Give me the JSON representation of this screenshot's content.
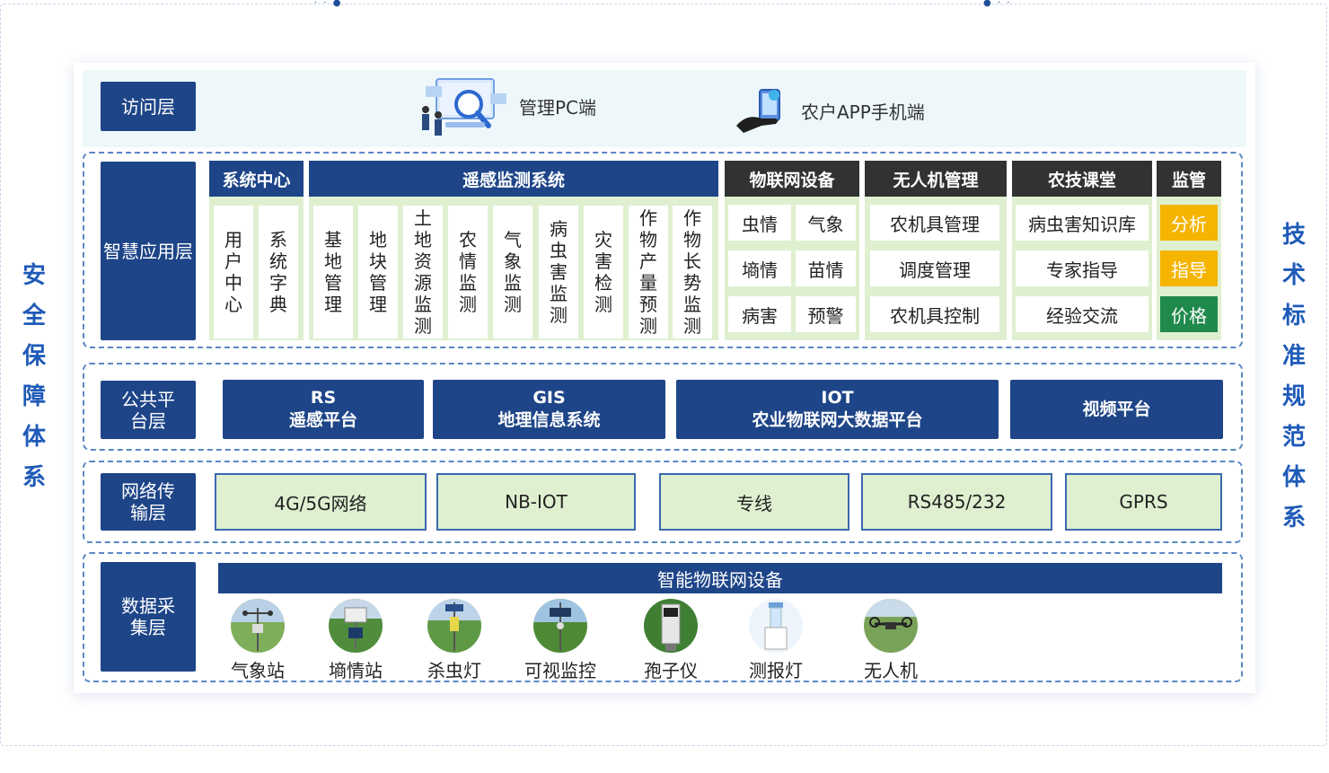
{
  "side_left": "安全保障体系",
  "side_right": "技术标准规范体系",
  "access": {
    "label": "访问层",
    "pc": "管理PC端",
    "app": "农户APP手机端"
  },
  "app_layer": {
    "label": "智慧应用层",
    "groups": [
      {
        "title": "系统中心",
        "items": [
          "用户中心",
          "系统字典"
        ]
      },
      {
        "title": "遥感监测系统",
        "items": [
          "基地管理",
          "地块管理",
          "土地资源监测",
          "农情监测",
          "气象监测",
          "病虫害监测",
          "灾害检测",
          "作物产量预测",
          "作物长势监测"
        ]
      },
      {
        "title": "物联网设备",
        "items": [
          "虫情",
          "气象",
          "墒情",
          "苗情",
          "病害",
          "预警"
        ]
      },
      {
        "title": "无人机管理",
        "items": [
          "农机具管理",
          "调度管理",
          "农机具控制"
        ]
      },
      {
        "title": "农技课堂",
        "items": [
          "病虫害知识库",
          "专家指导",
          "经验交流"
        ]
      },
      {
        "title": "监管",
        "items": [
          "分析",
          "指导",
          "价格"
        ]
      }
    ]
  },
  "colors": {
    "navy": "#1e4588",
    "dark": "#323232",
    "green_light": "#dff0d0",
    "tag_yellow": "#f5b400",
    "tag_green": "#1f8a4c",
    "side_blue": "#1e5ab8"
  },
  "platform_layer": {
    "label": "公共平台层",
    "items": [
      {
        "line1": "RS",
        "line2": "遥感平台"
      },
      {
        "line1": "GIS",
        "line2": "地理信息系统"
      },
      {
        "line1": "IOT",
        "line2": "农业物联网大数据平台"
      },
      {
        "line1": "",
        "line2": "视频平台"
      }
    ]
  },
  "network_layer": {
    "label": "网络传输层",
    "items": [
      "4G/5G网络",
      "NB-IOT",
      "专线",
      "RS485/232",
      "GPRS"
    ]
  },
  "data_layer": {
    "label": "数据采集层",
    "bar": "智能物联网设备",
    "devices": [
      "气象站",
      "墒情站",
      "杀虫灯",
      "可视监控",
      "孢子仪",
      "测报灯",
      "无人机"
    ]
  }
}
